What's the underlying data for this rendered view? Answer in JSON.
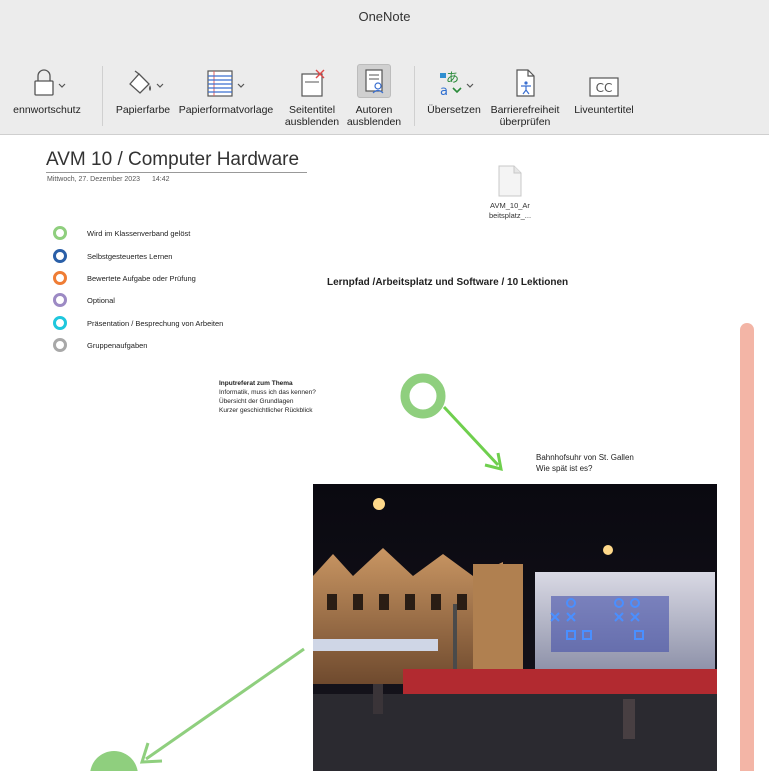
{
  "app": {
    "window_title": "OneNote"
  },
  "ribbon": {
    "password_label": "ennwortschutz",
    "paper_color_label": "Papierfarbe",
    "paper_template_label": "Papierformatvorlage",
    "hide_page_title_line1": "Seitentitel",
    "hide_page_title_line2": "ausblenden",
    "hide_authors_line1": "Autoren",
    "hide_authors_line2": "ausblenden",
    "translate_label": "Übersetzen",
    "accessibility_line1": "Barrierefreiheit",
    "accessibility_line2": "überprüfen",
    "live_captions_label": "Liveuntertitel",
    "cc_glyph": "CC",
    "translate_glyph_a": "a",
    "translate_glyph_jp": "あ"
  },
  "page": {
    "title": "AVM 10 / Computer Hardware",
    "date": "Mittwoch, 27. Dezember 2023",
    "time": "14:42",
    "attachment_line1": "AVM_10_Ar",
    "attachment_line2": "beitsplatz_...",
    "legend": [
      {
        "label": "Wird im Klassenverband gelöst",
        "color": "#8fcf7e"
      },
      {
        "label": "Selbstgesteuertes Lernen",
        "color": "#2a5fa8"
      },
      {
        "label": "Bewertete Aufgabe oder Prüfung",
        "color": "#ef7d35"
      },
      {
        "label": "Optional",
        "color": "#9c8ac4"
      },
      {
        "label": "Präsentation / Besprechung von Arbeiten",
        "color": "#1fc7dd"
      },
      {
        "label": "Gruppenaufgaben",
        "color": "#a8a8a8"
      }
    ],
    "path_title": "Lernpfad /Arbeitsplatz und Software / 10 Lektionen",
    "note": {
      "heading": "Inputreferat zum Thema",
      "line1": "Informatik, muss ich das kennen?",
      "line2": "Übersicht der Grundlagen",
      "line3": "Kurzer geschichtlicher Rückblick"
    },
    "station_note": {
      "line1": "Bahnhofsuhr von St. Gallen",
      "line2": "Wie spät ist es?"
    },
    "accent_green": "#8fcf7e",
    "arrow_green": "#6fcf4e"
  }
}
